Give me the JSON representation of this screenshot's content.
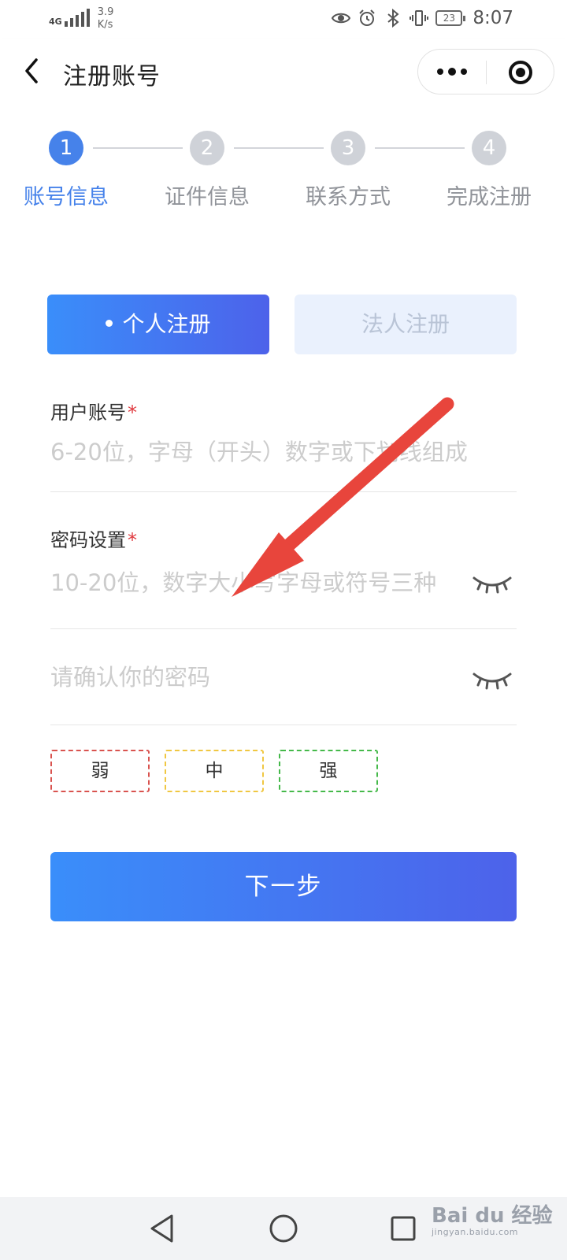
{
  "status_bar": {
    "network": "4G",
    "speed_value": "3.9",
    "speed_unit": "K/s",
    "battery": "23",
    "time": "8:07"
  },
  "header": {
    "title": "注册账号",
    "back_icon": "chevron-left-icon",
    "more_icon": "more-dots-icon",
    "close_icon": "target-circle-icon"
  },
  "steps": [
    {
      "number": "1",
      "label": "账号信息",
      "active": true
    },
    {
      "number": "2",
      "label": "证件信息",
      "active": false
    },
    {
      "number": "3",
      "label": "联系方式",
      "active": false
    },
    {
      "number": "4",
      "label": "完成注册",
      "active": false
    }
  ],
  "tabs": {
    "personal": "个人注册",
    "legal": "法人注册",
    "selected": "personal"
  },
  "form": {
    "account": {
      "label": "用户账号",
      "required_mark": "*",
      "placeholder": "6-20位，字母（开头）数字或下划线组成",
      "value": ""
    },
    "password": {
      "label": "密码设置",
      "required_mark": "*",
      "placeholder": "10-20位，数字大小写字母或符号三种",
      "value": ""
    },
    "confirm": {
      "placeholder": "请确认你的密码",
      "value": ""
    },
    "strength": {
      "weak": "弱",
      "medium": "中",
      "strong": "强"
    },
    "submit_label": "下一步"
  },
  "colors": {
    "primary": "#4682ea",
    "gradient_start": "#3a8efa",
    "gradient_end": "#4d62ea",
    "weak": "#d9534f",
    "medium": "#f0c742",
    "strong": "#45b94a",
    "annotation_arrow": "#e8453c"
  },
  "watermark": {
    "text": "Bai du 经验",
    "url": "jingyan.baidu.com"
  }
}
